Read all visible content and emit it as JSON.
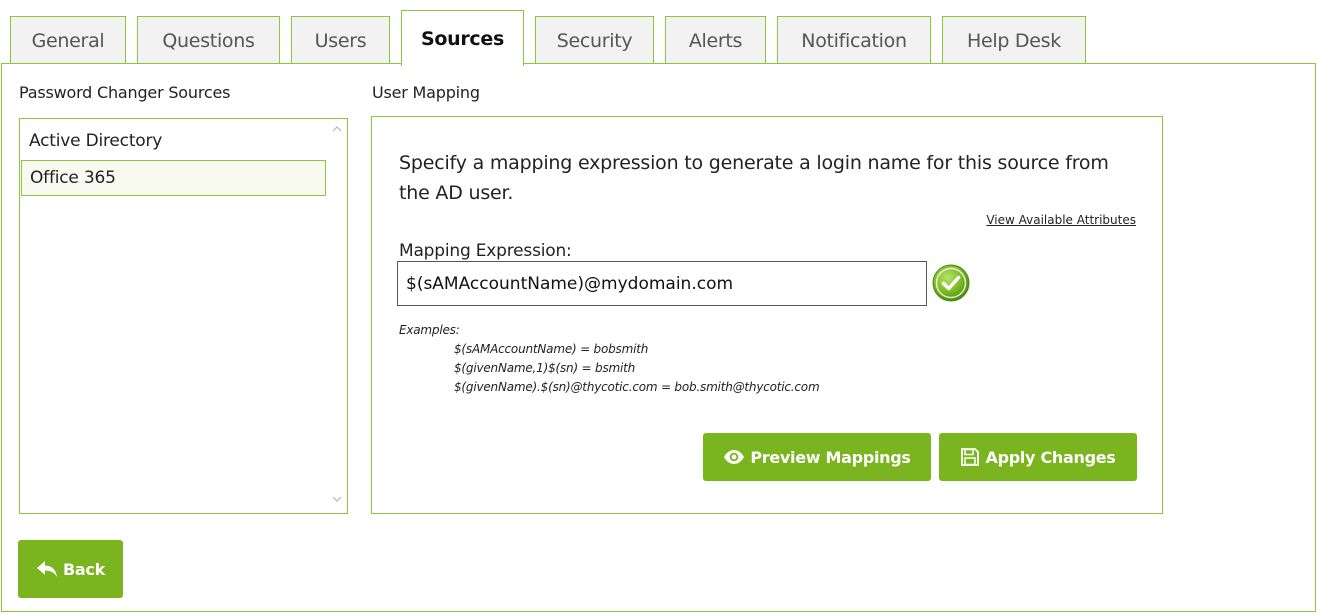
{
  "tabs": [
    {
      "label": "General",
      "active": false
    },
    {
      "label": "Questions",
      "active": false
    },
    {
      "label": "Users",
      "active": false
    },
    {
      "label": "Sources",
      "active": true
    },
    {
      "label": "Security",
      "active": false
    },
    {
      "label": "Alerts",
      "active": false
    },
    {
      "label": "Notification",
      "active": false
    },
    {
      "label": "Help Desk",
      "active": false
    }
  ],
  "sources_panel": {
    "title": "Password Changer Sources",
    "items": [
      {
        "label": "Active Directory",
        "selected": false
      },
      {
        "label": "Office 365",
        "selected": true
      }
    ]
  },
  "mapping": {
    "title": "User Mapping",
    "description": "Specify a mapping expression to generate a login name for this source from the AD user.",
    "attributes_link": "View Available Attributes",
    "expression_label": "Mapping Expression:",
    "expression_value": "$(sAMAccountName)@mydomain.com",
    "valid_icon": "check-circle-icon",
    "examples_title": "Examples:",
    "examples": [
      "$(sAMAccountName) = bobsmith",
      "$(givenName,1)$(sn) = bsmith",
      "$(givenName).$(sn)@thycotic.com = bob.smith@thycotic.com"
    ],
    "preview_button": "Preview Mappings",
    "apply_button": "Apply Changes"
  },
  "back_button": "Back",
  "colors": {
    "accent": "#8cc63f",
    "button": "#7ab41f"
  }
}
